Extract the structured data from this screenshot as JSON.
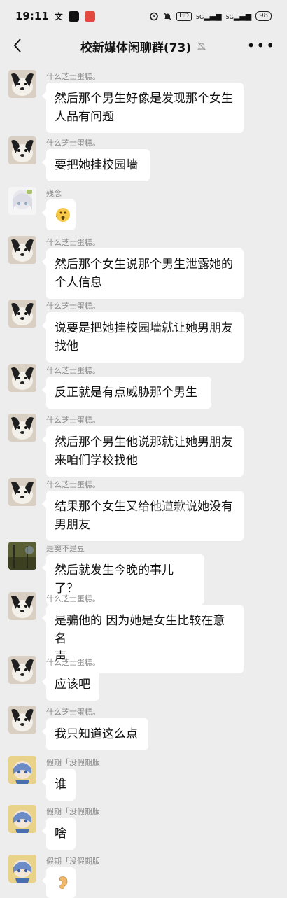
{
  "status_bar": {
    "time": "19:11",
    "hd": "HD",
    "net1": "5G",
    "net2": "5G",
    "battery": "98"
  },
  "header": {
    "title": "校新媒体闲聊群(73)"
  },
  "watermark": "bga",
  "messages": [
    {
      "sender": "什么芝士蛋糕。",
      "text": "然后那个男生好像是发现那个女生\n人品有问题",
      "avatar": "dog"
    },
    {
      "sender": "什么芝士蛋糕。",
      "text": "要把她挂校园墙",
      "avatar": "dog"
    },
    {
      "sender": "残念",
      "text": "",
      "emoji": "surprised-face",
      "avatar": "anime-white"
    },
    {
      "sender": "什么芝士蛋糕。",
      "text": "然后那个女生说那个男生泄露她的\n个人信息",
      "avatar": "dog"
    },
    {
      "sender": "什么芝士蛋糕。",
      "text": "说要是把她挂校园墙就让她男朋友\n找他",
      "avatar": "dog"
    },
    {
      "sender": "什么芝士蛋糕。",
      "text": "反正就是有点威胁那个男生",
      "avatar": "dog"
    },
    {
      "sender": "什么芝士蛋糕。",
      "text": "然后那个男生他说那就让她男朋友\n来咱们学校找他",
      "avatar": "dog"
    },
    {
      "sender": "什么芝士蛋糕。",
      "text": "结果那个女生又给他道歉说她没有\n男朋友",
      "avatar": "dog"
    },
    {
      "sender": "是窦不是豆",
      "text": "然后就发生今晚的事儿了？",
      "avatar": "scenery"
    },
    {
      "sender": "什么芝士蛋糕。",
      "text": "是骗他的 因为她是女生比较在意名\n声",
      "avatar": "dog"
    },
    {
      "sender": "什么芝士蛋糕。",
      "text": "应该吧",
      "avatar": "dog"
    },
    {
      "sender": "什么芝士蛋糕。",
      "text": "我只知道这么点",
      "avatar": "dog"
    },
    {
      "sender": "假期「没假期版",
      "text": "谁",
      "avatar": "anime-blue"
    },
    {
      "sender": "假期「没假期版",
      "text": "啥",
      "avatar": "anime-blue"
    },
    {
      "sender": "假期「没假期版",
      "text": "",
      "emoji": "ear",
      "avatar": "anime-blue"
    }
  ]
}
